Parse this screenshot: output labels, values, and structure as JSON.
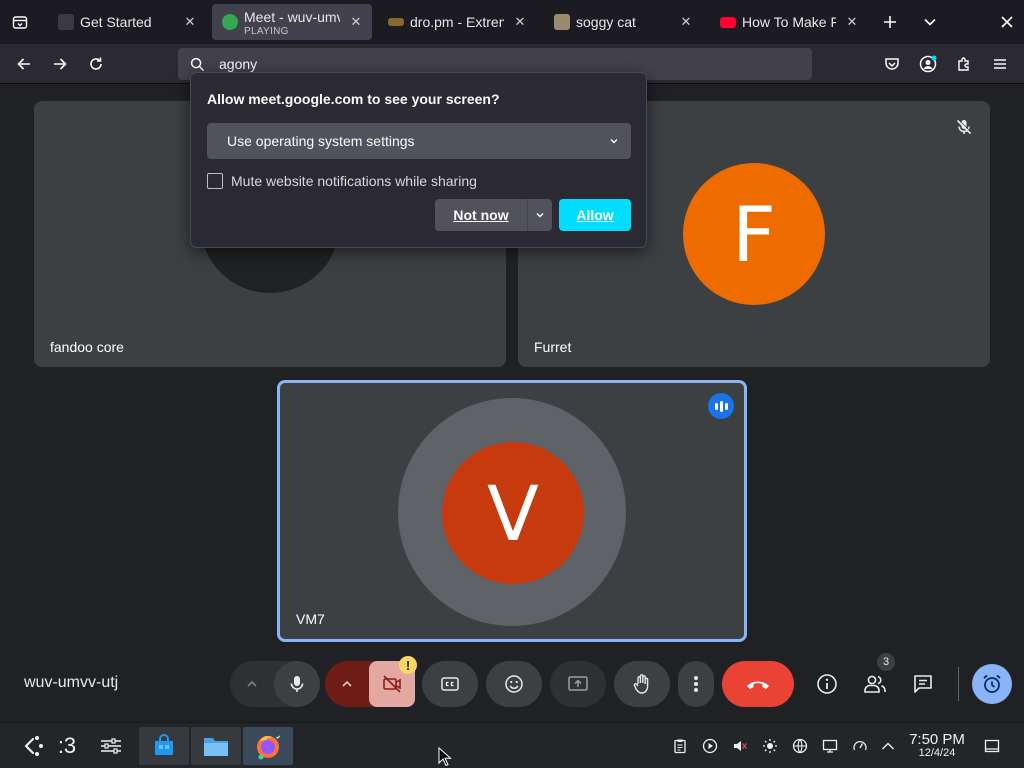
{
  "browser": {
    "tabs": [
      {
        "title": "Get Started",
        "subtitle": "",
        "active": false
      },
      {
        "title": "Meet - wuv-umvv-utj",
        "subtitle": "PLAYING",
        "active": true
      },
      {
        "title": "dro.pm - Extreme",
        "subtitle": "",
        "active": false
      },
      {
        "title": "soggy cat",
        "subtitle": "",
        "active": false
      },
      {
        "title": "How To Make F",
        "subtitle": "",
        "active": false
      }
    ],
    "address_value": "agony"
  },
  "permission_popup": {
    "title": "Allow meet.google.com to see your screen?",
    "select_value": "Use operating system settings",
    "checkbox_label": "Mute website notifications while sharing",
    "checkbox_checked": false,
    "not_now_label": "Not now",
    "allow_label": "Allow"
  },
  "meet": {
    "participants": [
      {
        "name": "fandoo core",
        "initial": ""
      },
      {
        "name": "Furret",
        "initial": "F",
        "muted": true,
        "avatar_color": "#ee6b00"
      },
      {
        "name": "VM7",
        "initial": "V",
        "speaking": true,
        "avatar_color": "#c63a0d"
      }
    ],
    "meeting_code": "wuv-umvv-utj",
    "people_count": "3",
    "camera_warning": "!"
  },
  "taskbar": {
    "pager_label": ":3",
    "time": "7:50 PM",
    "date": "12/4/24"
  },
  "colors": {
    "allow_button": "#00ddff",
    "end_call": "#ea4335",
    "camera_off": "#f28b82",
    "speaking_border": "#8ab4f8"
  }
}
